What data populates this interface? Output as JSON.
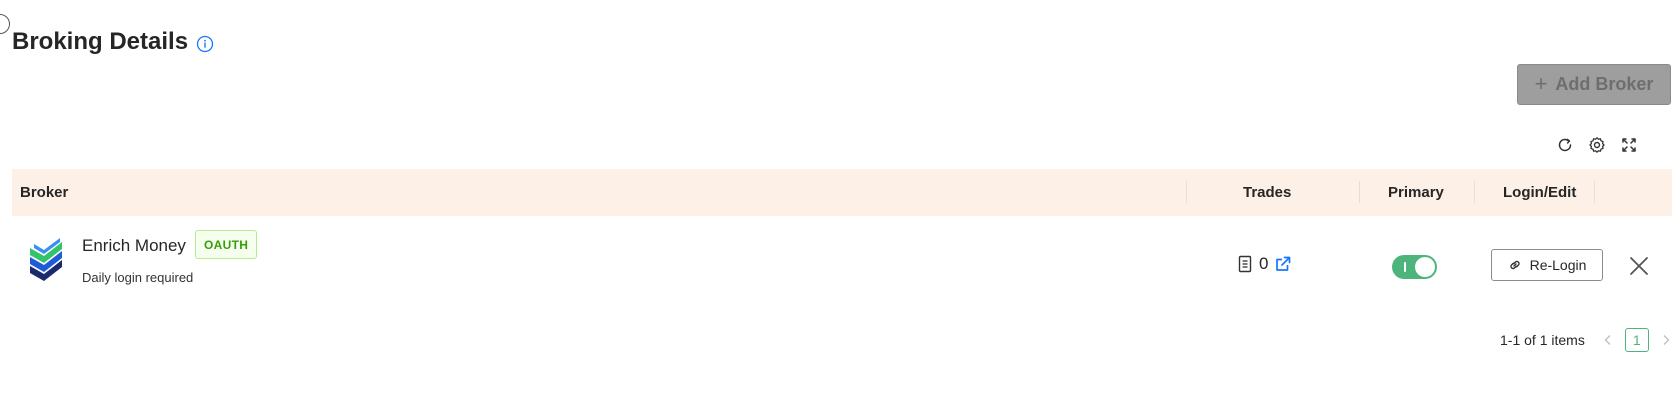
{
  "header": {
    "title": "Broking Details"
  },
  "actions": {
    "add_broker_label": "Add Broker",
    "add_broker_plus": "+"
  },
  "table": {
    "columns": {
      "broker": "Broker",
      "trades": "Trades",
      "primary": "Primary",
      "login_edit": "Login/Edit"
    },
    "rows": [
      {
        "broker_name": "Enrich Money",
        "auth_tag": "OAUTH",
        "subtitle": "Daily login required",
        "trades": "0",
        "primary": true,
        "action_label": "Re-Login"
      }
    ]
  },
  "pagination": {
    "summary": "1-1 of 1 items",
    "current_page": "1"
  },
  "colors": {
    "header_bg": "#fdf1e7",
    "primary_green": "#4db47c",
    "tag_green": "#389e0d",
    "disabled_button": "#9e9e9e",
    "link_blue": "#1677ff"
  },
  "icons": [
    "info-icon",
    "plus-icon",
    "refresh-icon",
    "settings-icon",
    "fullscreen-icon",
    "document-icon",
    "external-link-icon",
    "link-icon",
    "close-icon",
    "chevron-left-icon",
    "chevron-right-icon"
  ]
}
